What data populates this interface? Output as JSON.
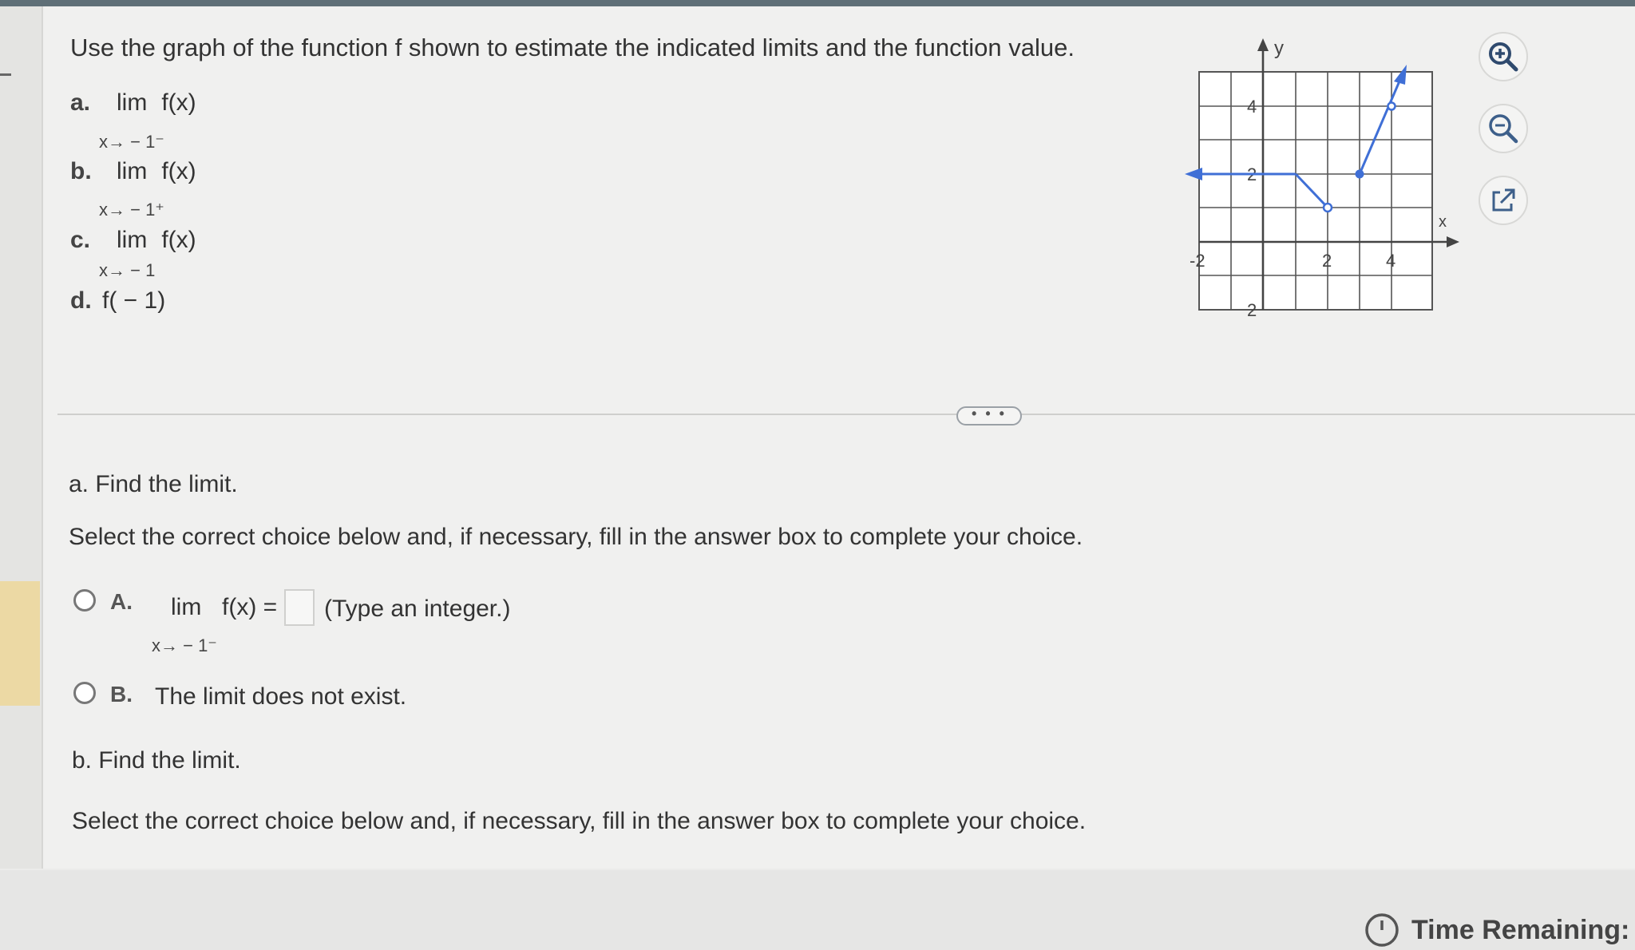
{
  "question": {
    "intro": "Use the graph of the function f shown to estimate the indicated limits and the function value.",
    "parts": [
      {
        "label": "a.",
        "lim": "lim",
        "func": "f(x)",
        "sub": "x→ − 1⁻"
      },
      {
        "label": "b.",
        "lim": "lim",
        "func": "f(x)",
        "sub": "x→ − 1⁺"
      },
      {
        "label": "c.",
        "lim": "lim",
        "func": "f(x)",
        "sub": "x→ − 1"
      },
      {
        "label": "d.",
        "expr": "f( − 1)"
      }
    ]
  },
  "graph": {
    "y_axis_label": "y",
    "x_axis_label": "x",
    "tick_labels": {
      "x_neg2": "-2",
      "x_2": "2",
      "x_4": "4",
      "y_4": "4",
      "y_2": "2",
      "y_neg2": "2"
    },
    "line_color": "#3f6fd6"
  },
  "tools": {
    "zoom_in": "zoom-in-icon",
    "zoom_out": "zoom-out-icon",
    "popout": "external-link-icon"
  },
  "expand_label": "• • •",
  "section_a": {
    "heading": "a. Find the limit.",
    "instruction": "Select the correct choice below and, if necessary, fill in the answer box to complete your choice.",
    "choice_a_letter": "A.",
    "choice_a_lim": "lim",
    "choice_a_func": "f(x) =",
    "choice_a_sub": "x→ − 1⁻",
    "choice_a_hint": "(Type an integer.)",
    "choice_b_letter": "B.",
    "choice_b_text": "The limit does not exist."
  },
  "section_b": {
    "heading": "b. Find the limit.",
    "instruction": "Select the correct choice below and, if necessary, fill in the answer box to complete your choice."
  },
  "timer": {
    "label": "Time Remaining:"
  }
}
